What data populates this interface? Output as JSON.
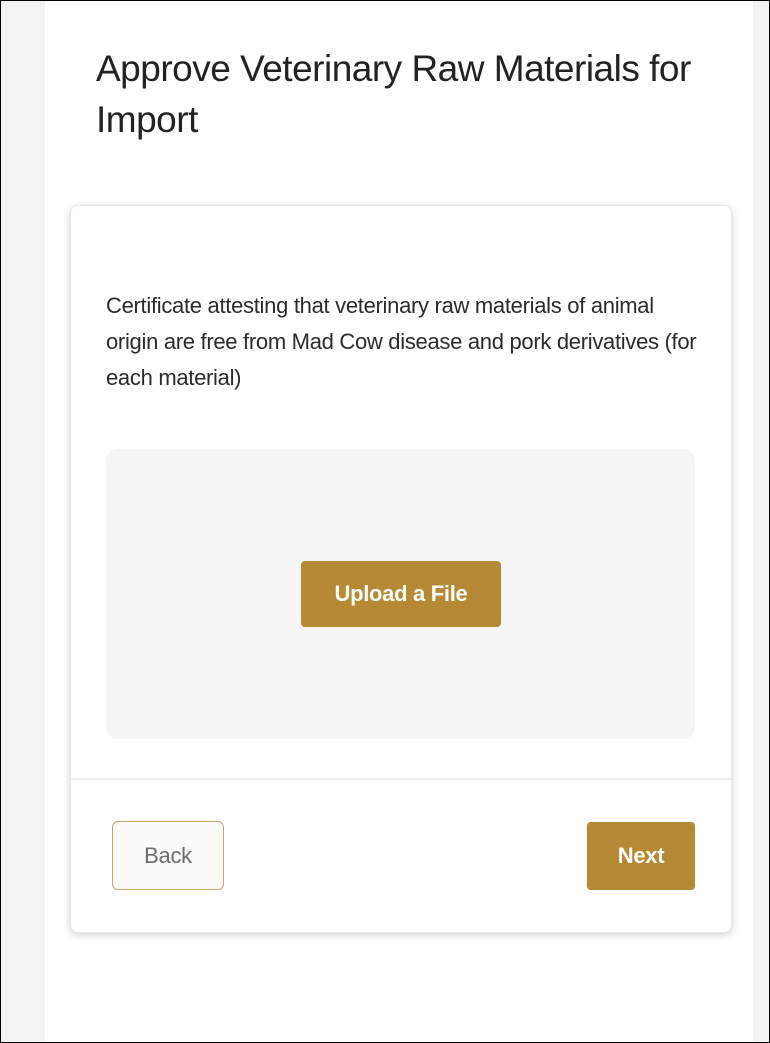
{
  "page": {
    "title": "Approve Veterinary Raw Materials for Import"
  },
  "card": {
    "description": "Certificate attesting that veterinary raw materials of animal origin are free from Mad Cow disease and pork derivatives (for each material)",
    "upload_label": "Upload a File",
    "back_label": "Back",
    "next_label": "Next"
  },
  "colors": {
    "accent": "#b68a35",
    "upload_zone_bg": "#f5f5f5",
    "back_border": "#c9a76a"
  }
}
